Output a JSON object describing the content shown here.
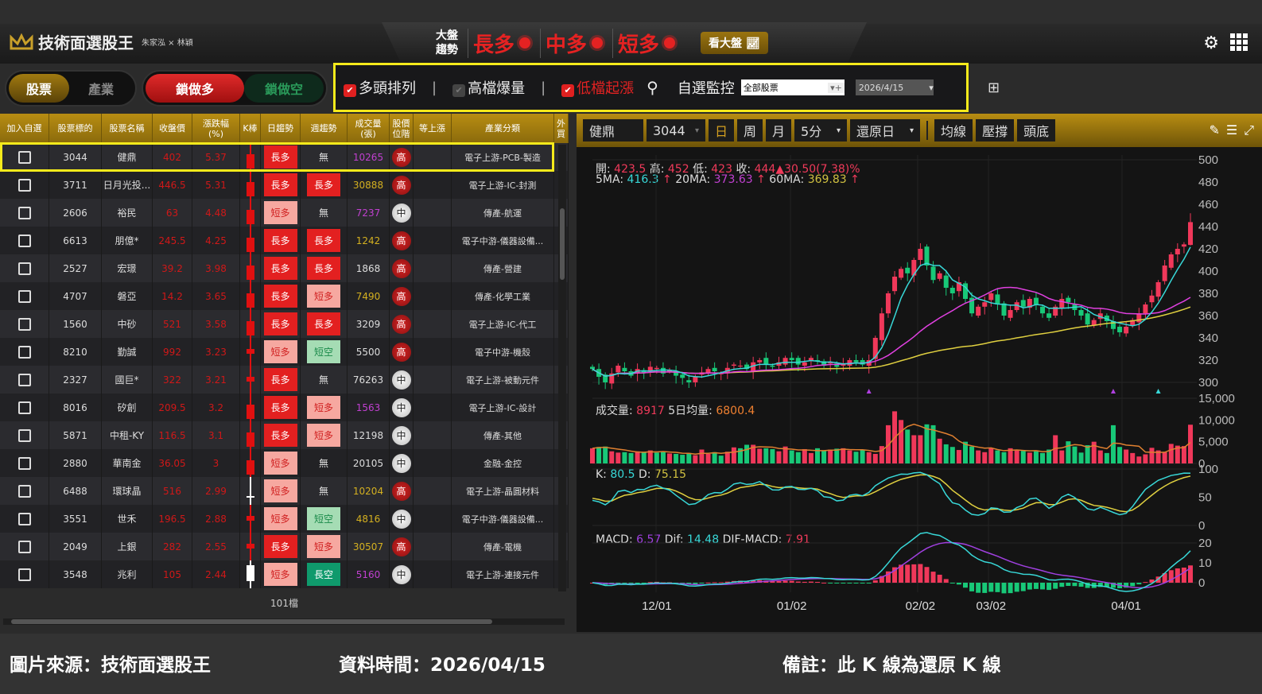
{
  "header": {
    "title": "技術面選股王",
    "subtitle": "朱家泓 × 林穎",
    "market_label_1": "大盤",
    "market_label_2": "趨勢",
    "trends": [
      "長多",
      "中多",
      "短多"
    ],
    "view_market_button": "看大盤"
  },
  "toggles": {
    "stock": "股票",
    "industry": "產業",
    "lock_long": "鎖做多",
    "lock_short": "鎖做空"
  },
  "filters": {
    "bull_alignment": {
      "label": "多頭排列",
      "checked": true
    },
    "high_volume": {
      "label": "高檔爆量",
      "checked": false
    },
    "low_rise": {
      "label": "低檔起漲",
      "checked": true
    },
    "watch_label": "自選監控",
    "watch_select": "全部股票",
    "date_select": "2026/4/15"
  },
  "table": {
    "columns": [
      "加入自選",
      "股票標的",
      "股票名稱",
      "收盤價",
      "漲跌幅\n(%)",
      "K棒",
      "日趨勢",
      "週趨勢",
      "成交量\n(張)",
      "股價\n位階",
      "等上漲",
      "產業分類",
      "外\n買"
    ],
    "rows": [
      {
        "code": "3044",
        "name": "健鼎",
        "close": "402",
        "chg": "5.37",
        "kbar": "red",
        "daily": "長多",
        "weekly": "無",
        "vol": "10265",
        "volColor": "#c040d0",
        "level": "高",
        "industry": "電子上游-PCB-製造"
      },
      {
        "code": "3711",
        "name": "日月光投...",
        "close": "446.5",
        "chg": "5.31",
        "kbar": "red",
        "daily": "長多",
        "weekly": "長多",
        "vol": "30888",
        "volColor": "#d4b020",
        "level": "高",
        "industry": "電子上游-IC-封測"
      },
      {
        "code": "2606",
        "name": "裕民",
        "close": "63",
        "chg": "4.48",
        "kbar": "red",
        "daily": "短多",
        "weekly": "無",
        "vol": "7237",
        "volColor": "#c040d0",
        "level": "中",
        "industry": "傳產-航運"
      },
      {
        "code": "6613",
        "name": "朋億*",
        "close": "245.5",
        "chg": "4.25",
        "kbar": "red",
        "daily": "長多",
        "weekly": "長多",
        "vol": "1242",
        "volColor": "#d4b020",
        "level": "高",
        "industry": "電子中游-儀器設備..."
      },
      {
        "code": "2527",
        "name": "宏璟",
        "close": "39.2",
        "chg": "3.98",
        "kbar": "red",
        "daily": "長多",
        "weekly": "長多",
        "vol": "1868",
        "volColor": "#dddddd",
        "level": "高",
        "industry": "傳產-營建"
      },
      {
        "code": "4707",
        "name": "磐亞",
        "close": "14.2",
        "chg": "3.65",
        "kbar": "red",
        "daily": "長多",
        "weekly": "短多",
        "vol": "7490",
        "volColor": "#d4b020",
        "level": "高",
        "industry": "傳產-化學工業"
      },
      {
        "code": "1560",
        "name": "中砂",
        "close": "521",
        "chg": "3.58",
        "kbar": "red",
        "daily": "長多",
        "weekly": "長多",
        "vol": "3209",
        "volColor": "#dddddd",
        "level": "高",
        "industry": "電子上游-IC-代工"
      },
      {
        "code": "8210",
        "name": "勤誠",
        "close": "992",
        "chg": "3.23",
        "kbar": "redsmall",
        "daily": "短多",
        "weekly": "短空",
        "vol": "5500",
        "volColor": "#dddddd",
        "level": "高",
        "industry": "電子中游-機殼"
      },
      {
        "code": "2327",
        "name": "國巨*",
        "close": "322",
        "chg": "3.21",
        "kbar": "redsmall",
        "daily": "長多",
        "weekly": "無",
        "vol": "76263",
        "volColor": "#dddddd",
        "level": "中",
        "industry": "電子上游-被動元件"
      },
      {
        "code": "8016",
        "name": "矽創",
        "close": "209.5",
        "chg": "3.2",
        "kbar": "red",
        "daily": "長多",
        "weekly": "短多",
        "vol": "1563",
        "volColor": "#c040d0",
        "level": "中",
        "industry": "電子上游-IC-設計"
      },
      {
        "code": "5871",
        "name": "中租-KY",
        "close": "116.5",
        "chg": "3.1",
        "kbar": "red",
        "daily": "長多",
        "weekly": "短多",
        "vol": "12198",
        "volColor": "#dddddd",
        "level": "中",
        "industry": "傳產-其他"
      },
      {
        "code": "2880",
        "name": "華南金",
        "close": "36.05",
        "chg": "3",
        "kbar": "red",
        "daily": "短多",
        "weekly": "無",
        "vol": "20105",
        "volColor": "#dddddd",
        "level": "中",
        "industry": "金融-金控"
      },
      {
        "code": "6488",
        "name": "環球晶",
        "close": "516",
        "chg": "2.99",
        "kbar": "cross",
        "daily": "短多",
        "weekly": "無",
        "vol": "10204",
        "volColor": "#d4b020",
        "level": "高",
        "industry": "電子上游-晶圓材料"
      },
      {
        "code": "3551",
        "name": "世禾",
        "close": "196.5",
        "chg": "2.88",
        "kbar": "redsmall",
        "daily": "短多",
        "weekly": "短空",
        "vol": "4816",
        "volColor": "#d4b020",
        "level": "中",
        "industry": "電子中游-儀器設備..."
      },
      {
        "code": "2049",
        "name": "上銀",
        "close": "282",
        "chg": "2.55",
        "kbar": "redsmall",
        "daily": "長多",
        "weekly": "短多",
        "vol": "30507",
        "volColor": "#d4b020",
        "level": "高",
        "industry": "傳產-電機"
      },
      {
        "code": "3548",
        "name": "兆利",
        "close": "105",
        "chg": "2.44",
        "kbar": "white",
        "daily": "短多",
        "weekly": "長空",
        "vol": "5160",
        "volColor": "#c040d0",
        "level": "中",
        "industry": "電子上游-連接元件"
      }
    ],
    "count": "101檔"
  },
  "chart_toolbar": {
    "name": "健鼎",
    "code": "3044",
    "day": "日",
    "week": "周",
    "month": "月",
    "interval": "5分",
    "adjust": "還原日",
    "ma": "均線",
    "support": "壓撐",
    "headbottom": "頭底"
  },
  "chart_info": {
    "open_label": "開:",
    "open": "423.5",
    "high_label": "高:",
    "high": "452",
    "low_label": "低:",
    "low": "423",
    "close_label": "收:",
    "close": "444▲30.50(7.38)%",
    "ma5_label": "5MA:",
    "ma5": "416.3",
    "ma20_label": "20MA:",
    "ma20": "373.63",
    "ma60_label": "60MA:",
    "ma60": "369.83",
    "arrow": "↑",
    "vol_label": "成交量:",
    "vol": "8917",
    "vol5_label": "5日均量:",
    "vol5": "6800.4",
    "k_label": "K:",
    "k": "80.5",
    "d_label": "D:",
    "d": "75.15",
    "macd_label": "MACD:",
    "macd": "6.57",
    "dif_label": "Dif:",
    "dif": "14.48",
    "osc_label": "DIF-MACD:",
    "osc": "7.91"
  },
  "chart_data": {
    "type": "candlestick",
    "price_axis": {
      "ticks": [
        "500",
        "480",
        "460",
        "440",
        "420",
        "400",
        "380",
        "360",
        "340",
        "320",
        "300"
      ],
      "range": [
        300,
        500
      ]
    },
    "volume_axis": {
      "ticks": [
        "15,000",
        "10,000",
        "5,000",
        "0"
      ],
      "range": [
        0,
        15000
      ]
    },
    "kd_axis": {
      "ticks": [
        "100",
        "50",
        "0"
      ],
      "range": [
        0,
        100
      ]
    },
    "macd_axis": {
      "ticks": [
        "20",
        "10",
        "0"
      ]
    },
    "x_labels": [
      {
        "label": "12/01",
        "index": 10
      },
      {
        "label": "01/02",
        "index": 31
      },
      {
        "label": "02/02",
        "index": 51
      },
      {
        "label": "03/02",
        "index": 62
      },
      {
        "label": "04/01",
        "index": 83
      }
    ],
    "closes": [
      312,
      305,
      300,
      308,
      315,
      310,
      306,
      312,
      309,
      314,
      313,
      308,
      311,
      306,
      304,
      300,
      305,
      309,
      312,
      310,
      308,
      313,
      316,
      315,
      312,
      318,
      320,
      316,
      314,
      318,
      322,
      320,
      316,
      318,
      322,
      319,
      315,
      318,
      314,
      317,
      320,
      318,
      316,
      320,
      340,
      362,
      380,
      395,
      402,
      398,
      410,
      420,
      405,
      392,
      398,
      385,
      380,
      390,
      375,
      362,
      368,
      372,
      380,
      370,
      360,
      365,
      372,
      368,
      375,
      370,
      362,
      358,
      368,
      375,
      372,
      365,
      360,
      352,
      356,
      362,
      355,
      348,
      345,
      350,
      356,
      362,
      370,
      378,
      390,
      405,
      415,
      420,
      424,
      444
    ],
    "volumes": [
      3500,
      3800,
      3900,
      2800,
      2500,
      2600,
      2400,
      2800,
      2600,
      3000,
      2500,
      2800,
      2300,
      2200,
      2000,
      2400,
      1900,
      3200,
      2200,
      2600,
      1800,
      2700,
      3700,
      3500,
      4300,
      4300,
      3400,
      3500,
      3300,
      2800,
      3900,
      3000,
      2600,
      3300,
      2400,
      3500,
      2900,
      3200,
      3400,
      3500,
      3000,
      2700,
      3200,
      2600,
      2200,
      4000,
      8800,
      12000,
      10000,
      7800,
      6500,
      6500,
      9000,
      8800,
      5700,
      4400,
      3800,
      3100,
      5000,
      3900,
      3000,
      2600,
      3500,
      3000,
      2600,
      3500,
      3000,
      2900,
      2500,
      2800,
      2400,
      3200,
      6500,
      3000,
      5100,
      3900,
      2500,
      4200,
      5000,
      3000,
      2400,
      8800,
      3800,
      3200,
      2400,
      1600,
      2100,
      3600,
      3000,
      2600,
      4500,
      4100,
      4000,
      8917
    ],
    "last_bar": {
      "open": 423.5,
      "high": 452,
      "low": 423,
      "close": 444
    },
    "colors": {
      "up": "#f0385a",
      "down": "#18c878",
      "ma5": "#38d8d8",
      "ma20": "#e040e0",
      "ma60": "#e0d040",
      "k": "#38d8d8",
      "d": "#e0d040",
      "macd": "#a040e0",
      "dif": "#38d8d8"
    }
  },
  "caption": {
    "source": "圖片來源：技術面選股王",
    "time": "資料時間：2026/04/15",
    "note": "備註：此 K 線為還原 K 線"
  }
}
